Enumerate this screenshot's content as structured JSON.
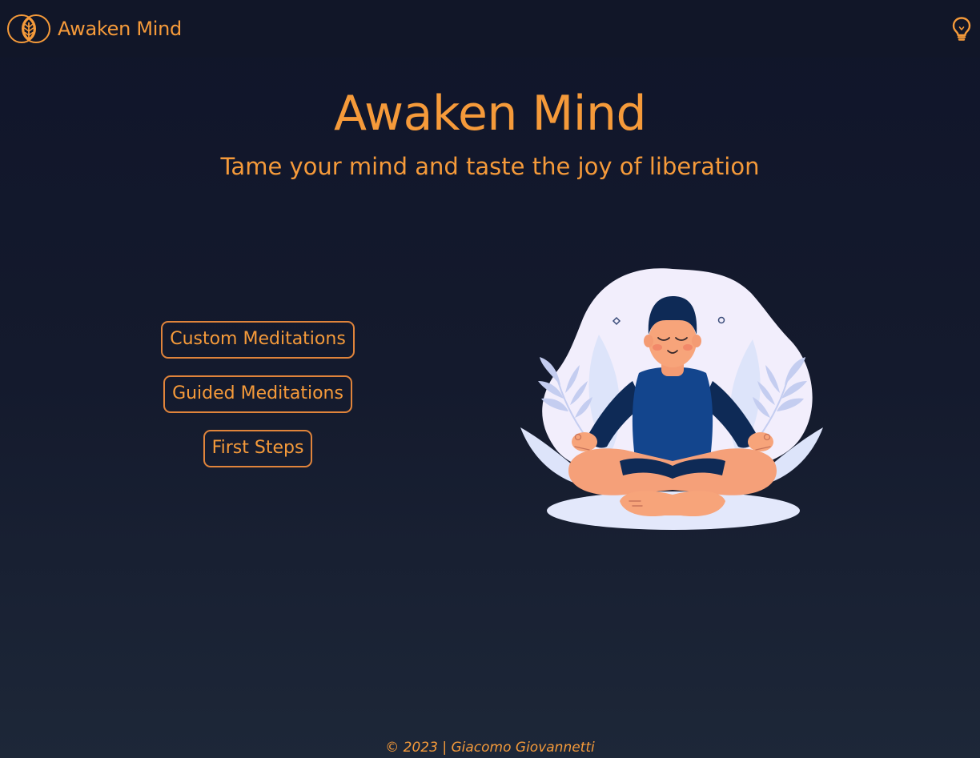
{
  "nav": {
    "brand_name": "Awaken Mind",
    "logo_icon": "leaf-circle-logo",
    "toggle_icon": "lightbulb-icon"
  },
  "hero": {
    "title": "Awaken Mind",
    "subtitle": "Tame your mind and taste the joy of liberation"
  },
  "menu": {
    "items": [
      {
        "label": "Custom Meditations"
      },
      {
        "label": "Guided Meditations"
      },
      {
        "label": "First Steps"
      }
    ]
  },
  "illustration": {
    "icon": "meditating-person-illustration"
  },
  "footer": {
    "copyright": "© 2023 | Giacomo Giovannetti"
  },
  "colors": {
    "accent": "#f59a3a",
    "button_border": "#e0843b",
    "background_top": "#10152a",
    "background_bottom": "#1d2738",
    "navbar": "#111628"
  }
}
